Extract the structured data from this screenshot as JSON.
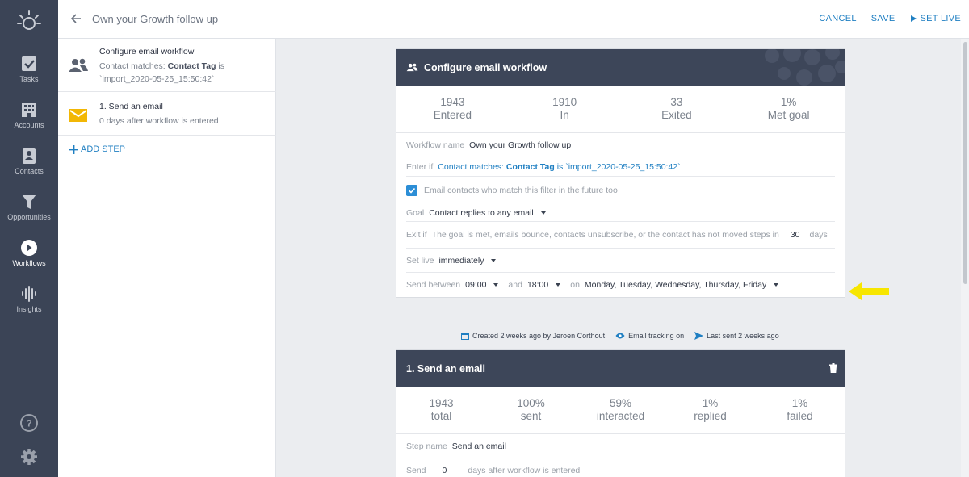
{
  "nav": {
    "items": [
      {
        "label": "Tasks",
        "icon": "check-square-icon"
      },
      {
        "label": "Accounts",
        "icon": "building-icon"
      },
      {
        "label": "Contacts",
        "icon": "contact-card-icon"
      },
      {
        "label": "Opportunities",
        "icon": "funnel-icon"
      },
      {
        "label": "Workflows",
        "icon": "play-circle-icon"
      },
      {
        "label": "Insights",
        "icon": "waveform-icon"
      }
    ],
    "active": "Workflows"
  },
  "header": {
    "title": "Own your Growth follow up",
    "cancel_label": "CANCEL",
    "save_label": "SAVE",
    "set_live_label": "SET LIVE"
  },
  "steps_panel": {
    "steps": [
      {
        "title": "Configure email workflow",
        "sub_prefix": "Contact matches: ",
        "sub_bold": "Contact Tag",
        "sub_suffix": " is",
        "sub_line2": "`import_2020-05-25_15:50:42`"
      },
      {
        "title": "1. Send an email",
        "sub": "0 days after workflow is entered"
      }
    ],
    "add_step_label": "ADD STEP"
  },
  "workflow_card": {
    "title": "Configure email workflow",
    "stats": [
      {
        "value": "1943",
        "label": "Entered"
      },
      {
        "value": "1910",
        "label": "In"
      },
      {
        "value": "33",
        "label": "Exited"
      },
      {
        "value": "1%",
        "label": "Met goal"
      }
    ],
    "workflow_name_label": "Workflow name",
    "workflow_name_value": "Own your Growth follow up",
    "enter_if_label": "Enter if",
    "enter_if_prefix": "Contact matches: ",
    "enter_if_bold": "Contact Tag",
    "enter_if_suffix": " is `import_2020-05-25_15:50:42`",
    "future_checkbox_label": "Email contacts who match this filter in the future too",
    "goal_label": "Goal",
    "goal_value": "Contact replies to any email",
    "exit_if_label": "Exit if",
    "exit_if_text": "The goal is met, emails bounce, contacts unsubscribe, or the contact has not moved steps in",
    "exit_days_value": "30",
    "exit_days_unit": "days",
    "set_live_label": "Set live",
    "set_live_value": "immediately",
    "send_between_label": "Send between",
    "send_from": "09:00",
    "and_label": "and",
    "send_to": "18:00",
    "on_label": "on",
    "send_days": "Monday, Tuesday, Wednesday, Thursday, Friday"
  },
  "meta": {
    "created": "Created 2 weeks ago by Jeroen Corthout",
    "tracking": "Email tracking on",
    "last_sent": "Last sent 2 weeks ago"
  },
  "email_card": {
    "title": "1. Send an email",
    "stats": [
      {
        "value": "1943",
        "label": "total"
      },
      {
        "value": "100%",
        "label": "sent"
      },
      {
        "value": "59%",
        "label": "interacted"
      },
      {
        "value": "1%",
        "label": "replied"
      },
      {
        "value": "1%",
        "label": "failed"
      }
    ],
    "step_name_label": "Step name",
    "step_name_value": "Send an email",
    "send_label": "Send",
    "send_days_value": "0",
    "send_days_suffix": "days after workflow is entered"
  },
  "colors": {
    "nav_bg": "#3b4456",
    "card_header": "#3d4659",
    "accent": "#1f7fc2",
    "highlight_arrow": "#f7e600",
    "email_icon": "#f2b705"
  }
}
